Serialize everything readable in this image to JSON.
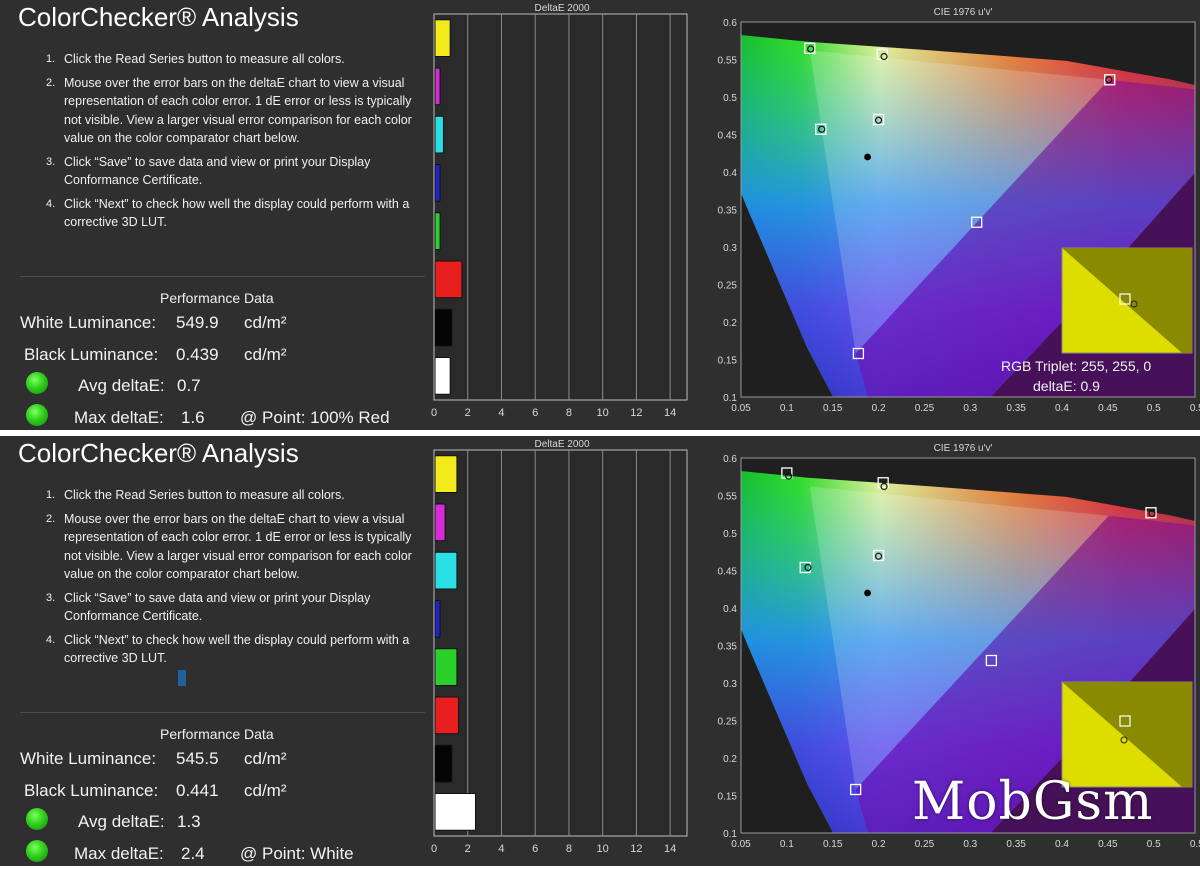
{
  "panels": [
    {
      "title": "ColorChecker® Analysis",
      "instructions": [
        {
          "num": "1.",
          "text": "Click the Read Series button to measure all colors."
        },
        {
          "num": "2.",
          "text": "Mouse over the error bars on the deltaE chart to view a visual representation of each color error. 1 dE error or less is typically not visible. View a larger visual error comparison for each color value on the color comparator chart below."
        },
        {
          "num": "3.",
          "text": "Click “Save” to save data and view or print your Display Conformance Certificate."
        },
        {
          "num": "4.",
          "text": "Click “Next” to check how well the display could perform with a corrective 3D LUT."
        }
      ],
      "performance": {
        "title": "Performance Data",
        "white_label": "White Luminance:",
        "white_value": "549.9",
        "black_label": "Black Luminance:",
        "black_value": "0.439",
        "unit": "cd/m²",
        "avg_label": "Avg deltaE:",
        "avg_value": "0.7",
        "max_label": "Max deltaE:",
        "max_value": "1.6",
        "point": "@ Point: 100% Red"
      },
      "chart_data": {
        "type": "bar",
        "title": "DeltaE 2000",
        "categories": [
          "Yellow",
          "Magenta",
          "Cyan",
          "Blue",
          "Green",
          "Red",
          "Black",
          "White"
        ],
        "colors": [
          "#f2ea1a",
          "#d62bd6",
          "#2adfe6",
          "#2222cc",
          "#2bd12b",
          "#e61e1e",
          "#050505",
          "#ffffff"
        ],
        "values": [
          0.9,
          0.3,
          0.5,
          0.3,
          0.3,
          1.6,
          1.0,
          0.9
        ],
        "xlim": [
          0,
          15
        ],
        "xticks": [
          "0",
          "2",
          "4",
          "6",
          "8",
          "10",
          "12",
          "14"
        ]
      },
      "cie": {
        "title": "CIE 1976 u'v'",
        "xticks": [
          "0.05",
          "0.1",
          "0.15",
          "0.2",
          "0.25",
          "0.3",
          "0.35",
          "0.4",
          "0.45",
          "0.5",
          "0.55"
        ],
        "yticks": [
          "0.6",
          "0.55",
          "0.5",
          "0.45",
          "0.4",
          "0.35",
          "0.3",
          "0.25",
          "0.2",
          "0.15",
          "0.1"
        ],
        "targets": [
          [
            0.125,
            0.565
          ],
          [
            0.204,
            0.557
          ],
          [
            0.452,
            0.523
          ],
          [
            0.2,
            0.47
          ],
          [
            0.137,
            0.457
          ],
          [
            0.307,
            0.333
          ],
          [
            0.178,
            0.158
          ]
        ],
        "measured": [
          [
            0.126,
            0.564
          ],
          [
            0.206,
            0.554
          ],
          [
            0.451,
            0.523
          ],
          [
            0.2,
            0.469
          ],
          [
            0.138,
            0.457
          ]
        ],
        "white_point": [
          0.188,
          0.42
        ],
        "tooltip_line1": "RGB Triplet: 255, 255, 0",
        "tooltip_line2": "deltaE: 0.9"
      }
    },
    {
      "title": "ColorChecker® Analysis",
      "instructions": [
        {
          "num": "1.",
          "text": "Click the Read Series button to measure all colors."
        },
        {
          "num": "2.",
          "text": "Mouse over the error bars on the deltaE chart to view a visual representation of each color error. 1 dE error or less is typically not visible. View a larger visual error comparison for each color value on the color comparator chart below."
        },
        {
          "num": "3.",
          "text": "Click “Save” to save data and view or print your Display Conformance Certificate."
        },
        {
          "num": "4.",
          "text": "Click “Next” to check how well the display could perform with a corrective 3D LUT."
        }
      ],
      "performance": {
        "title": "Performance Data",
        "white_label": "White Luminance:",
        "white_value": "545.5",
        "black_label": "Black Luminance:",
        "black_value": "0.441",
        "unit": "cd/m²",
        "avg_label": "Avg deltaE:",
        "avg_value": "1.3",
        "max_label": "Max deltaE:",
        "max_value": "2.4",
        "point": "@ Point: White"
      },
      "chart_data": {
        "type": "bar",
        "title": "DeltaE 2000",
        "categories": [
          "Yellow",
          "Magenta",
          "Cyan",
          "Blue",
          "Green",
          "Red",
          "Black",
          "White"
        ],
        "colors": [
          "#f2ea1a",
          "#d62bd6",
          "#2adfe6",
          "#2222cc",
          "#2bd12b",
          "#e61e1e",
          "#050505",
          "#ffffff"
        ],
        "values": [
          1.3,
          0.6,
          1.3,
          0.3,
          1.3,
          1.4,
          1.0,
          2.4
        ],
        "xlim": [
          0,
          15
        ],
        "xticks": [
          "0",
          "2",
          "4",
          "6",
          "8",
          "10",
          "12",
          "14"
        ]
      },
      "cie": {
        "title": "CIE 1976 u'v'",
        "xticks": [
          "0.05",
          "0.1",
          "0.15",
          "0.2",
          "0.25",
          "0.3",
          "0.35",
          "0.4",
          "0.45",
          "0.5",
          "0.55"
        ],
        "yticks": [
          "0.6",
          "0.55",
          "0.5",
          "0.45",
          "0.4",
          "0.35",
          "0.3",
          "0.25",
          "0.2",
          "0.15",
          "0.1"
        ],
        "targets": [
          [
            0.1,
            0.58
          ],
          [
            0.205,
            0.567
          ],
          [
            0.497,
            0.527
          ],
          [
            0.2,
            0.47
          ],
          [
            0.12,
            0.454
          ],
          [
            0.323,
            0.33
          ],
          [
            0.175,
            0.158
          ]
        ],
        "measured": [
          [
            0.102,
            0.576
          ],
          [
            0.206,
            0.562
          ],
          [
            0.498,
            0.526
          ],
          [
            0.2,
            0.469
          ],
          [
            0.123,
            0.454
          ]
        ],
        "white_point": [
          0.188,
          0.42
        ]
      }
    }
  ],
  "watermark": "MobGsm"
}
